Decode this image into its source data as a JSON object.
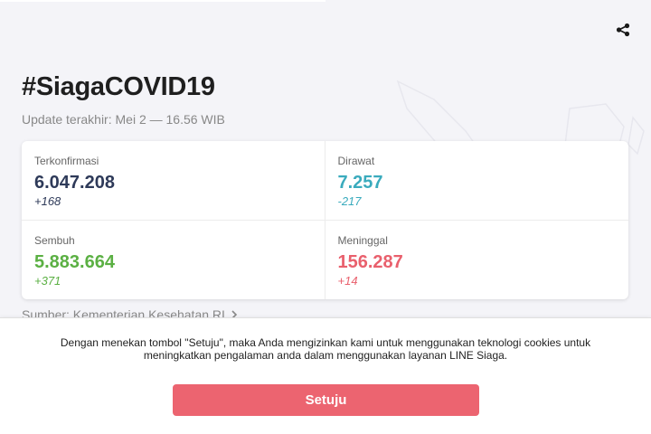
{
  "page": {
    "title": "#SiagaCOVID19",
    "updated": "Update terakhir: Mei 2 — 16.56 WIB",
    "source_label": "Sumber: Kementerian Kesehatan RI"
  },
  "stats": [
    {
      "label": "Terkonfirmasi",
      "value": "6.047.208",
      "delta": "+168",
      "color": "#2e3a59"
    },
    {
      "label": "Dirawat",
      "value": "7.257",
      "delta": "-217",
      "color": "#3aabbd"
    },
    {
      "label": "Sembuh",
      "value": "5.883.664",
      "delta": "+371",
      "color": "#5bb043"
    },
    {
      "label": "Meninggal",
      "value": "156.287",
      "delta": "+14",
      "color": "#e9606d"
    }
  ],
  "consent": {
    "text": "Dengan menekan tombol \"Setuju\", maka Anda mengizinkan kami untuk menggunakan teknologi cookies untuk meningkatkan pengalaman anda dalam menggunakan layanan LINE Siaga.",
    "button_label": "Setuju",
    "button_color": "#ec6470"
  },
  "icons": {
    "share": "share-icon",
    "chevron": "chevron-right-icon",
    "map": "indonesia-map-icon"
  }
}
